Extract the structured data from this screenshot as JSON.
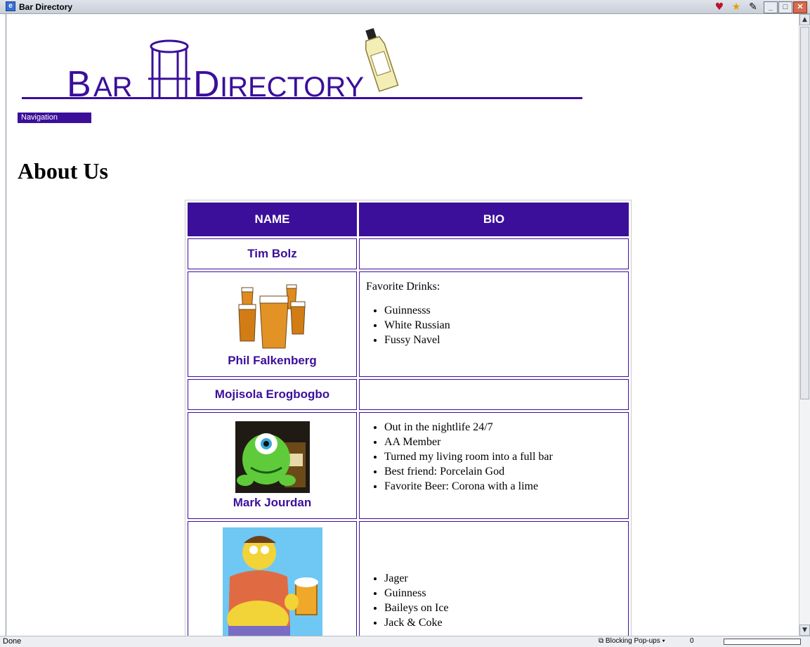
{
  "window": {
    "title": "Bar Directory"
  },
  "header": {
    "logo_text": "Bar Directory",
    "nav_label": "Navigation"
  },
  "page": {
    "title": "About Us"
  },
  "table": {
    "headers": [
      "NAME",
      "BIO"
    ],
    "rows": [
      {
        "name": "Tim Bolz"
      },
      {
        "name": "Phil Falkenberg",
        "bio_intro": "Favorite Drinks:",
        "bio_items": [
          "Guinnesss",
          "White Russian",
          "Fussy Navel"
        ]
      },
      {
        "name": "Mojisola Erogbogbo"
      },
      {
        "name": "Mark Jourdan",
        "bio_items": [
          "Out in the nightlife 24/7",
          "AA Member",
          "Turned my living room into a full bar",
          "Best friend: Porcelain God",
          "Favorite Beer: Corona with a lime"
        ]
      },
      {
        "bio_items": [
          "Jager",
          "Guinness",
          "Baileys on Ice",
          "Jack & Coke"
        ]
      }
    ]
  },
  "statusbar": {
    "status": "Done",
    "popup_label": "Blocking Pop-ups",
    "popup_count": "0"
  },
  "colors": {
    "brand_purple": "#3b0f9a"
  }
}
